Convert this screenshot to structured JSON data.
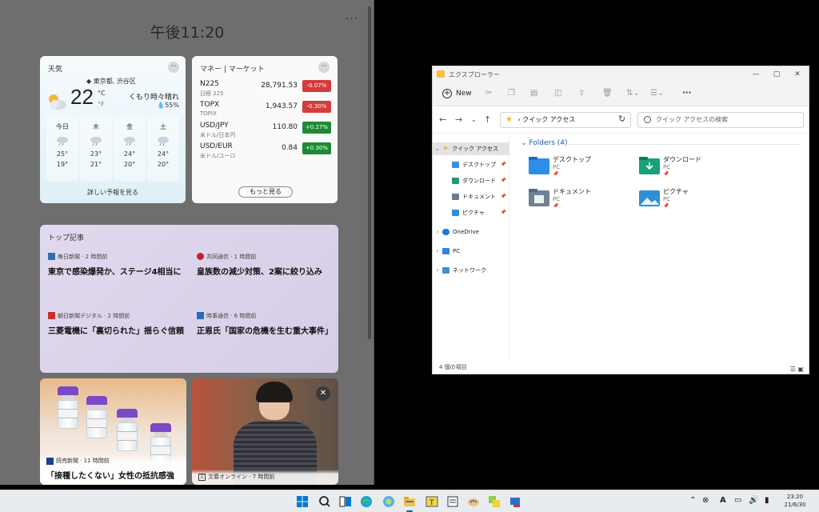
{
  "widgets": {
    "clock": "午後11:20",
    "more": "...",
    "weather": {
      "title": "天気",
      "location": "東京都, 渋谷区",
      "temp": "22",
      "unit_c": "°C",
      "unit_f": "°F",
      "condition": "くもり時々晴れ",
      "humidity": "55%",
      "days": [
        {
          "name": "今日",
          "high": "25°",
          "low": "19°"
        },
        {
          "name": "木",
          "high": "23°",
          "low": "21°"
        },
        {
          "name": "金",
          "high": "24°",
          "low": "20°"
        },
        {
          "name": "土",
          "high": "24°",
          "low": "20°"
        }
      ],
      "forecast_link": "詳しい予報を見る"
    },
    "market": {
      "title": "マネー | マーケット",
      "rows": [
        {
          "symbol": "N225",
          "sub": "日経 225",
          "value": "28,791.53",
          "change": "-0.07%",
          "dir": "neg"
        },
        {
          "symbol": "TOPX",
          "sub": "TOPIX",
          "value": "1,943.57",
          "change": "-0.30%",
          "dir": "neg"
        },
        {
          "symbol": "USD/JPY",
          "sub": "米ドル/日本円",
          "value": "110.80",
          "change": "+0.27%",
          "dir": "pos"
        },
        {
          "symbol": "USD/EUR",
          "sub": "米ドル/ユーロ",
          "value": "0.84",
          "change": "+0.30%",
          "dir": "pos"
        }
      ],
      "more": "もっと見る"
    },
    "stories": {
      "title": "トップ記事",
      "items": [
        {
          "source": "毎日新聞 · 2 時間前",
          "headline": "東京で感染爆発か、ステージ4相当に",
          "logo": "#2f6fb6"
        },
        {
          "source": "共同通信 · 1 時間前",
          "headline": "皇族数の減少対策、2案に絞り込み",
          "logo": "#c91f2c"
        },
        {
          "source": "朝日新聞デジタル · 2 時間前",
          "headline": "三菱電機に「裏切られた」揺らぐ信頼",
          "logo": "#c4302b"
        },
        {
          "source": "時事通信 · 6 時間前",
          "headline": "正恩氏「国家の危機を生む重大事件」",
          "logo": "#2a6cb5"
        }
      ]
    },
    "image_cards": [
      {
        "source": "読売新聞 · 11 時間前",
        "headline": "「接種したくない」女性の抵抗感強"
      },
      {
        "source": "文春オンライン · 7 時間前",
        "headline": ""
      }
    ]
  },
  "explorer": {
    "title": "エクスプローラー",
    "new_label": "New",
    "address": "クイック アクセス",
    "search_placeholder": "クイック アクセスの検索",
    "nav": [
      {
        "label": "クイック アクセス",
        "icon": "star-icon",
        "color": "#f1b52c",
        "selected": true
      },
      {
        "label": "デスクトップ",
        "icon": "desktop-icon",
        "color": "#3a8ee6"
      },
      {
        "label": "ダウンロード",
        "icon": "download-icon",
        "color": "#1f9b6c"
      },
      {
        "label": "ドキュメント",
        "icon": "documents-icon",
        "color": "#6c7a8a"
      },
      {
        "label": "ピクチャ",
        "icon": "pictures-icon",
        "color": "#2f8fd8"
      },
      {
        "label": "OneDrive",
        "icon": "onedrive-icon",
        "color": "#1e78d6"
      },
      {
        "label": "PC",
        "icon": "pc-icon",
        "color": "#2d86d9"
      },
      {
        "label": "ネットワーク",
        "icon": "network-icon",
        "color": "#3f8fd6"
      }
    ],
    "group_title": "Folders (4)",
    "folders": [
      {
        "name": "デスクトップ",
        "location": "PC",
        "color": "#2c8ee8"
      },
      {
        "name": "ダウンロード",
        "location": "PC",
        "color": "#18a07a"
      },
      {
        "name": "ドキュメント",
        "location": "PC",
        "color": "#6f8295"
      },
      {
        "name": "ピクチャ",
        "location": "PC",
        "color": "#2f8fd8"
      }
    ],
    "status": "4 個の項目"
  },
  "taskbar": {
    "time": "23:20",
    "date": "21/6/30"
  }
}
